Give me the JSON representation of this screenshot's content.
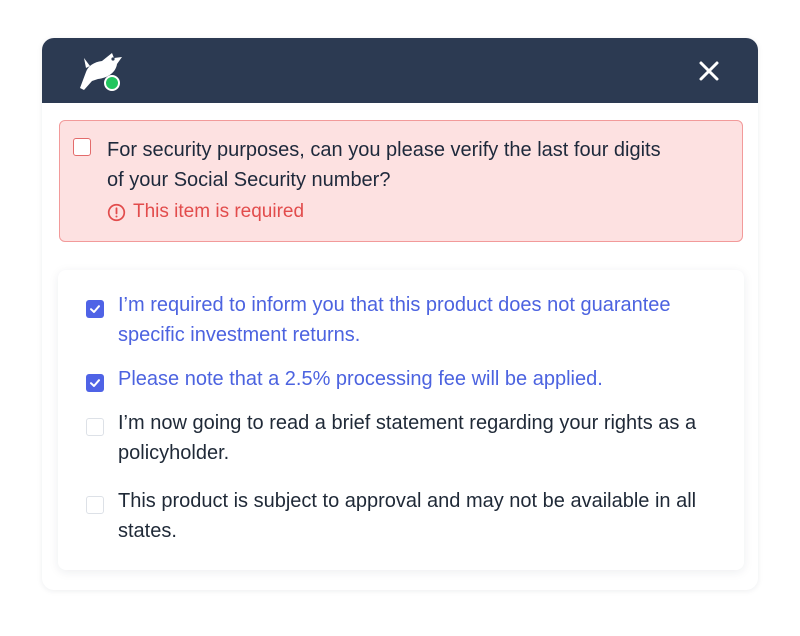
{
  "alert": {
    "question": "For security purposes, can you please verify the last four digits of your Social Security number?",
    "error": "This item is required",
    "checked": false
  },
  "items": [
    {
      "label": "I’m required to inform you that this product does not guarantee specific investment returns.",
      "checked": true
    },
    {
      "label": "Please note that a 2.5% processing fee will be applied.",
      "checked": true
    },
    {
      "label": "I’m now going to read a brief statement regarding your rights as a policyholder.",
      "checked": false
    },
    {
      "label": "This product is subject to approval and may not be available in all states.",
      "checked": false
    }
  ],
  "colors": {
    "header_bg": "#2c3a52",
    "accent": "#4f63e6",
    "error": "#e24c4c",
    "error_bg": "#fde1e1",
    "status_dot": "#22c55e"
  },
  "icons": {
    "logo": "bird-logo-icon",
    "status": "status-dot-icon",
    "close": "close-icon",
    "error": "alert-circle-icon",
    "check": "check-icon"
  }
}
